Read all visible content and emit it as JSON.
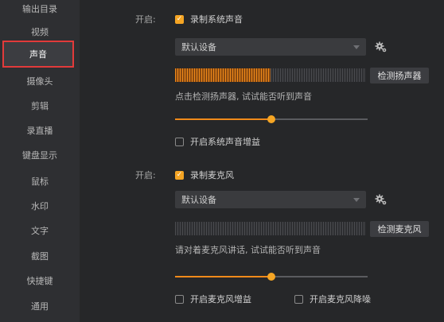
{
  "sidebar": {
    "items": [
      {
        "label": "输出目录",
        "active": false
      },
      {
        "label": "视频",
        "active": false
      },
      {
        "label": "声音",
        "active": true
      },
      {
        "label": "摄像头",
        "active": false
      },
      {
        "label": "剪辑",
        "active": false
      },
      {
        "label": "录直播",
        "active": false
      },
      {
        "label": "键盘显示",
        "active": false
      },
      {
        "label": "鼠标",
        "active": false
      },
      {
        "label": "水印",
        "active": false
      },
      {
        "label": "文字",
        "active": false
      },
      {
        "label": "截图",
        "active": false
      },
      {
        "label": "快捷键",
        "active": false
      },
      {
        "label": "通用",
        "active": false
      }
    ]
  },
  "system_audio": {
    "enable_label": "开启:",
    "record_label": "录制系统声音",
    "record_checked": true,
    "device": "默认设备",
    "level": 0.5,
    "test_button": "检测扬声器",
    "hint": "点击检测扬声器, 试试能否听到声音",
    "volume": 0.5,
    "boost_label": "开启系统声音增益",
    "boost_checked": false
  },
  "microphone": {
    "enable_label": "开启:",
    "record_label": "录制麦克风",
    "record_checked": true,
    "device": "默认设备",
    "level": 0,
    "test_button": "检测麦克风",
    "hint": "请对着麦克风讲话, 试试能否听到声音",
    "volume": 0.5,
    "boost_label": "开启麦克风增益",
    "boost_checked": false,
    "denoise_label": "开启麦克风降噪",
    "denoise_checked": false
  },
  "colors": {
    "accent": "#f5a524",
    "active_outline": "#e23a3a",
    "background": "#262729",
    "sidebar": "#2e2f32"
  }
}
